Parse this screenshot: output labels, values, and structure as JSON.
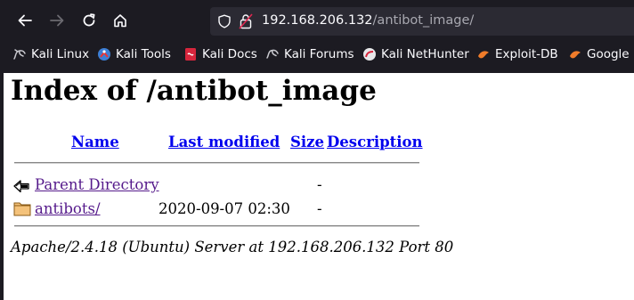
{
  "browser": {
    "url_host": "192.168.206.132",
    "url_path": "/antibot_image/",
    "bookmarks": [
      {
        "label": "Kali Linux",
        "icon": "kali-dragon-icon"
      },
      {
        "label": "Kali Tools",
        "icon": "kali-tools-icon"
      },
      {
        "label": "Kali Docs",
        "icon": "kali-docs-icon"
      },
      {
        "label": "Kali Forums",
        "icon": "kali-forums-icon"
      },
      {
        "label": "Kali NetHunter",
        "icon": "kali-nethunter-icon"
      },
      {
        "label": "Exploit-DB",
        "icon": "exploit-db-icon"
      },
      {
        "label": "Google H",
        "icon": "google-hacking-icon"
      }
    ]
  },
  "page": {
    "title": "Index of /antibot_image",
    "columns": {
      "name": "Name",
      "last_modified": "Last modified",
      "size": "Size",
      "description": "Description"
    },
    "rows": [
      {
        "name": "Parent Directory",
        "modified": "",
        "size": "-",
        "icon": "back-arrow-icon"
      },
      {
        "name": "antibots/",
        "modified": "2020-09-07 02:30",
        "size": "-",
        "icon": "folder-icon"
      }
    ],
    "footer": "Apache/2.4.18 (Ubuntu) Server at 192.168.206.132 Port 80"
  }
}
